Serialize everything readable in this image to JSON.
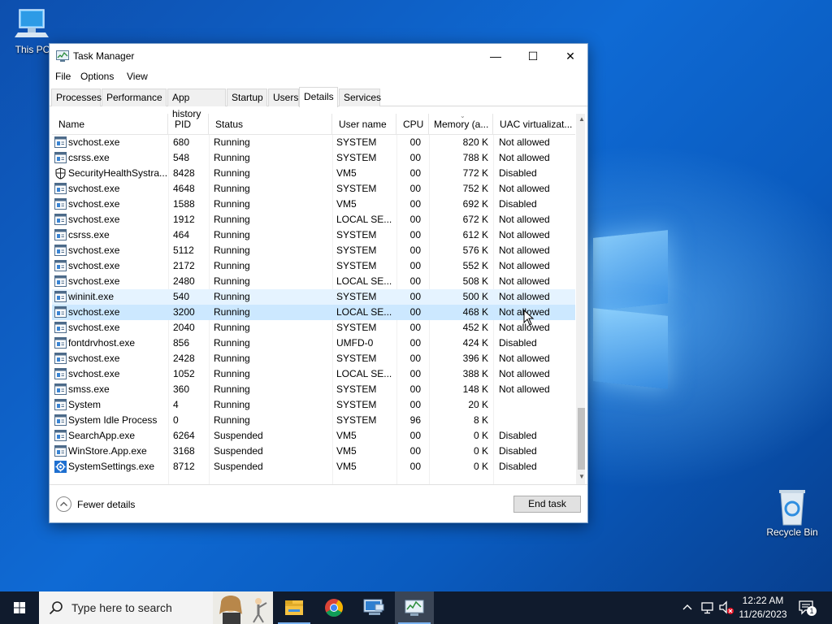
{
  "desktop": {
    "icons": {
      "this_pc": "This PC",
      "recycle_bin": "Recycle Bin"
    }
  },
  "window": {
    "title": "Task Manager",
    "controls": {
      "minimize": "—",
      "maximize": "☐",
      "close": "✕"
    },
    "menu": [
      "File",
      "Options",
      "View"
    ],
    "tabs": [
      "Processes",
      "Performance",
      "App history",
      "Startup",
      "Users",
      "Details",
      "Services"
    ],
    "active_tab": "Details",
    "columns": [
      "Name",
      "PID",
      "Status",
      "User name",
      "CPU",
      "Memory (a...",
      "UAC virtualizat..."
    ],
    "rows": [
      {
        "name": "svchost.exe",
        "pid": "680",
        "status": "Running",
        "user": "SYSTEM",
        "cpu": "00",
        "mem": "820 K",
        "uac": "Not allowed",
        "icon": "window"
      },
      {
        "name": "csrss.exe",
        "pid": "548",
        "status": "Running",
        "user": "SYSTEM",
        "cpu": "00",
        "mem": "788 K",
        "uac": "Not allowed",
        "icon": "window"
      },
      {
        "name": "SecurityHealthSystra...",
        "pid": "8428",
        "status": "Running",
        "user": "VM5",
        "cpu": "00",
        "mem": "772 K",
        "uac": "Disabled",
        "icon": "shield"
      },
      {
        "name": "svchost.exe",
        "pid": "4648",
        "status": "Running",
        "user": "SYSTEM",
        "cpu": "00",
        "mem": "752 K",
        "uac": "Not allowed",
        "icon": "window"
      },
      {
        "name": "svchost.exe",
        "pid": "1588",
        "status": "Running",
        "user": "VM5",
        "cpu": "00",
        "mem": "692 K",
        "uac": "Disabled",
        "icon": "window"
      },
      {
        "name": "svchost.exe",
        "pid": "1912",
        "status": "Running",
        "user": "LOCAL SE...",
        "cpu": "00",
        "mem": "672 K",
        "uac": "Not allowed",
        "icon": "window"
      },
      {
        "name": "csrss.exe",
        "pid": "464",
        "status": "Running",
        "user": "SYSTEM",
        "cpu": "00",
        "mem": "612 K",
        "uac": "Not allowed",
        "icon": "window"
      },
      {
        "name": "svchost.exe",
        "pid": "5112",
        "status": "Running",
        "user": "SYSTEM",
        "cpu": "00",
        "mem": "576 K",
        "uac": "Not allowed",
        "icon": "window"
      },
      {
        "name": "svchost.exe",
        "pid": "2172",
        "status": "Running",
        "user": "SYSTEM",
        "cpu": "00",
        "mem": "552 K",
        "uac": "Not allowed",
        "icon": "window"
      },
      {
        "name": "svchost.exe",
        "pid": "2480",
        "status": "Running",
        "user": "LOCAL SE...",
        "cpu": "00",
        "mem": "508 K",
        "uac": "Not allowed",
        "icon": "window"
      },
      {
        "name": "wininit.exe",
        "pid": "540",
        "status": "Running",
        "user": "SYSTEM",
        "cpu": "00",
        "mem": "500 K",
        "uac": "Not allowed",
        "icon": "window",
        "state": "hover"
      },
      {
        "name": "svchost.exe",
        "pid": "3200",
        "status": "Running",
        "user": "LOCAL SE...",
        "cpu": "00",
        "mem": "468 K",
        "uac": "Not allowed",
        "icon": "window",
        "state": "selected"
      },
      {
        "name": "svchost.exe",
        "pid": "2040",
        "status": "Running",
        "user": "SYSTEM",
        "cpu": "00",
        "mem": "452 K",
        "uac": "Not allowed",
        "icon": "window"
      },
      {
        "name": "fontdrvhost.exe",
        "pid": "856",
        "status": "Running",
        "user": "UMFD-0",
        "cpu": "00",
        "mem": "424 K",
        "uac": "Disabled",
        "icon": "window"
      },
      {
        "name": "svchost.exe",
        "pid": "2428",
        "status": "Running",
        "user": "SYSTEM",
        "cpu": "00",
        "mem": "396 K",
        "uac": "Not allowed",
        "icon": "window"
      },
      {
        "name": "svchost.exe",
        "pid": "1052",
        "status": "Running",
        "user": "LOCAL SE...",
        "cpu": "00",
        "mem": "388 K",
        "uac": "Not allowed",
        "icon": "window"
      },
      {
        "name": "smss.exe",
        "pid": "360",
        "status": "Running",
        "user": "SYSTEM",
        "cpu": "00",
        "mem": "148 K",
        "uac": "Not allowed",
        "icon": "window"
      },
      {
        "name": "System",
        "pid": "4",
        "status": "Running",
        "user": "SYSTEM",
        "cpu": "00",
        "mem": "20 K",
        "uac": "",
        "icon": "window"
      },
      {
        "name": "System Idle Process",
        "pid": "0",
        "status": "Running",
        "user": "SYSTEM",
        "cpu": "96",
        "mem": "8 K",
        "uac": "",
        "icon": "window"
      },
      {
        "name": "SearchApp.exe",
        "pid": "6264",
        "status": "Suspended",
        "user": "VM5",
        "cpu": "00",
        "mem": "0 K",
        "uac": "Disabled",
        "icon": "window"
      },
      {
        "name": "WinStore.App.exe",
        "pid": "3168",
        "status": "Suspended",
        "user": "VM5",
        "cpu": "00",
        "mem": "0 K",
        "uac": "Disabled",
        "icon": "window"
      },
      {
        "name": "SystemSettings.exe",
        "pid": "8712",
        "status": "Suspended",
        "user": "VM5",
        "cpu": "00",
        "mem": "0 K",
        "uac": "Disabled",
        "icon": "gear"
      }
    ],
    "footer": {
      "fewer_details": "Fewer details",
      "end_task": "End task"
    }
  },
  "taskbar": {
    "search_placeholder": "Type here to search",
    "apps": [
      "file-explorer-icon",
      "chrome-icon",
      "remote-desktop-icon",
      "task-manager-icon"
    ],
    "clock": {
      "time": "12:22 AM",
      "date": "11/26/2023"
    },
    "notification_count": "1"
  },
  "colors": {
    "selected_row": "#cce8ff",
    "hover_row": "#e5f3ff",
    "taskbar": "#101b2d",
    "accent": "#0078d7"
  }
}
